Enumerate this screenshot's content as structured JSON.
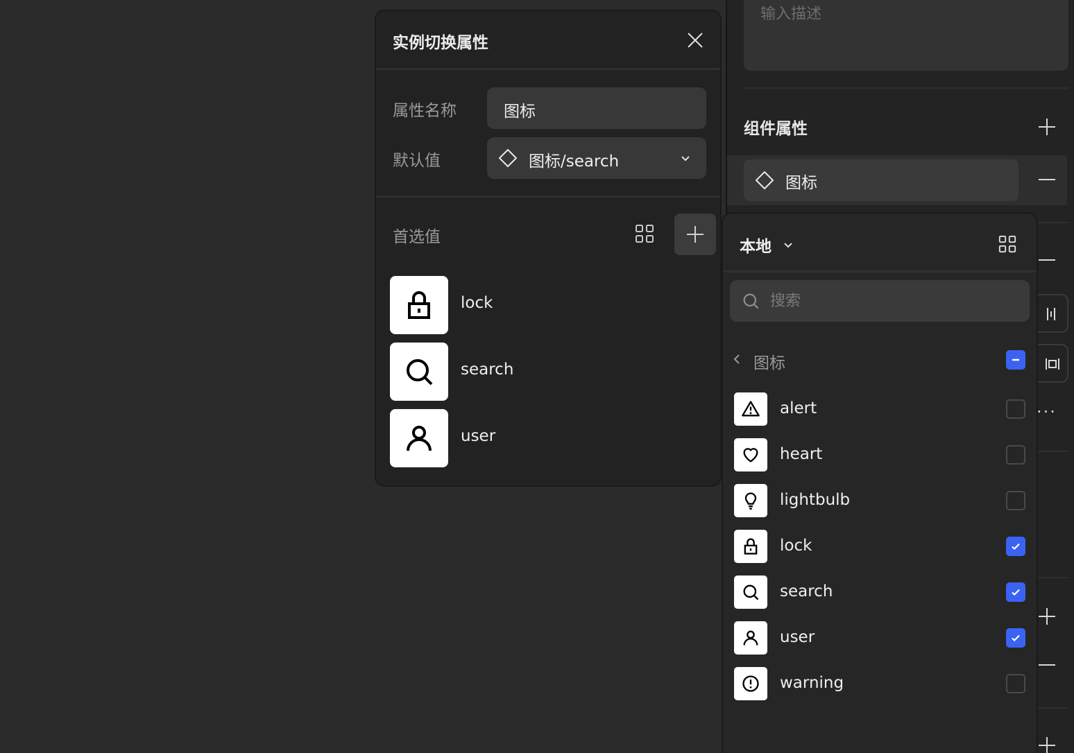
{
  "right_panel": {
    "description_placeholder": "输入描述",
    "component_props_title": "组件属性",
    "property_chip_label": "图标"
  },
  "dialog": {
    "title": "实例切换属性",
    "name_label": "属性名称",
    "name_value": "图标",
    "default_label": "默认值",
    "default_value": "图标/search",
    "preferred_label": "首选值",
    "preferred": [
      {
        "label": "lock",
        "icon": "lock-icon"
      },
      {
        "label": "search",
        "icon": "search-icon"
      },
      {
        "label": "user",
        "icon": "user-icon"
      }
    ]
  },
  "picker": {
    "source": "本地",
    "search_placeholder": "搜索",
    "folder": "图标",
    "folder_state": "mixed",
    "items": [
      {
        "label": "alert",
        "icon": "alert-icon",
        "checked": false
      },
      {
        "label": "heart",
        "icon": "heart-icon",
        "checked": false
      },
      {
        "label": "lightbulb",
        "icon": "lightbulb-icon",
        "checked": false
      },
      {
        "label": "lock",
        "icon": "lock-icon",
        "checked": true
      },
      {
        "label": "search",
        "icon": "search-icon",
        "checked": true
      },
      {
        "label": "user",
        "icon": "user-icon",
        "checked": true
      },
      {
        "label": "warning",
        "icon": "warning-icon",
        "checked": false
      }
    ]
  },
  "colors": {
    "accent": "#3b63f3",
    "background": "#2b2b2b",
    "panel": "#222222"
  }
}
